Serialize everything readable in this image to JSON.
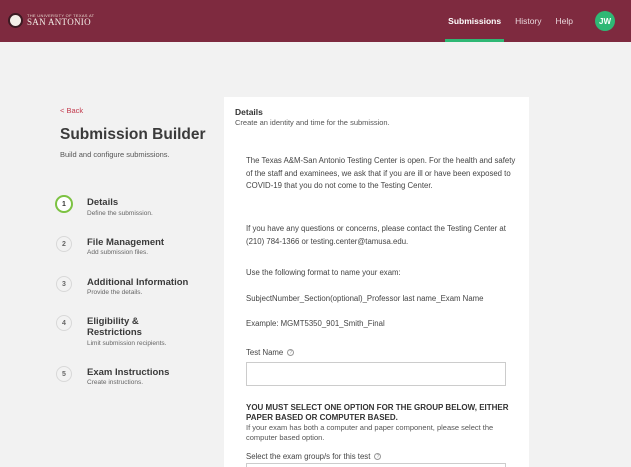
{
  "header": {
    "logo_small": "THE UNIVERSITY OF TEXAS AT",
    "logo_big": "SAN ANTONIO",
    "nav": [
      {
        "label": "Submissions",
        "active": true
      },
      {
        "label": "History",
        "active": false
      },
      {
        "label": "Help",
        "active": false
      }
    ],
    "avatar_initials": "JW",
    "colors": {
      "bar": "#7e2a3f",
      "accent": "#2fb875"
    }
  },
  "sidebar": {
    "back_label": "< Back",
    "title": "Submission Builder",
    "subtitle": "Build and configure submissions.",
    "steps": [
      {
        "number": "1",
        "label": "Details",
        "desc": "Define the submission.",
        "active": true
      },
      {
        "number": "2",
        "label": "File Management",
        "desc": "Add submission files.",
        "active": false
      },
      {
        "number": "3",
        "label": "Additional Information",
        "desc": "Provide the details.",
        "active": false
      },
      {
        "number": "4",
        "label": "Eligibility & Restrictions",
        "desc": "Limit submission recipients.",
        "active": false
      },
      {
        "number": "5",
        "label": "Exam Instructions",
        "desc": "Create instructions.",
        "active": false
      }
    ]
  },
  "main": {
    "title": "Details",
    "subtitle": "Create an identity and time for the submission.",
    "paragraphs": [
      "The Texas A&M-San Antonio Testing Center is open.  For the health and safety of the staff and examinees, we ask that if you are ill or have been exposed to COVID-19 that you do not come to the Testing Center.",
      "If you have any questions or concerns, please contact the Testing Center at (210) 784-1366 or testing.center@tamusa.edu.",
      "Use the following format to name your exam:",
      "SubjectNumber_Section(optional)_Professor last name_Exam Name",
      "Example:  MGMT5350_901_Smith_Final"
    ],
    "test_name_label": "Test Name",
    "test_name_value": "",
    "warning_heading": "YOU MUST SELECT ONE OPTION FOR THE GROUP BELOW, EITHER PAPER BASED OR COMPUTER BASED.",
    "warning_body": "If your exam has both a computer and paper component, please select the computer based option.",
    "group_label": "Select the exam group/s for this test"
  }
}
